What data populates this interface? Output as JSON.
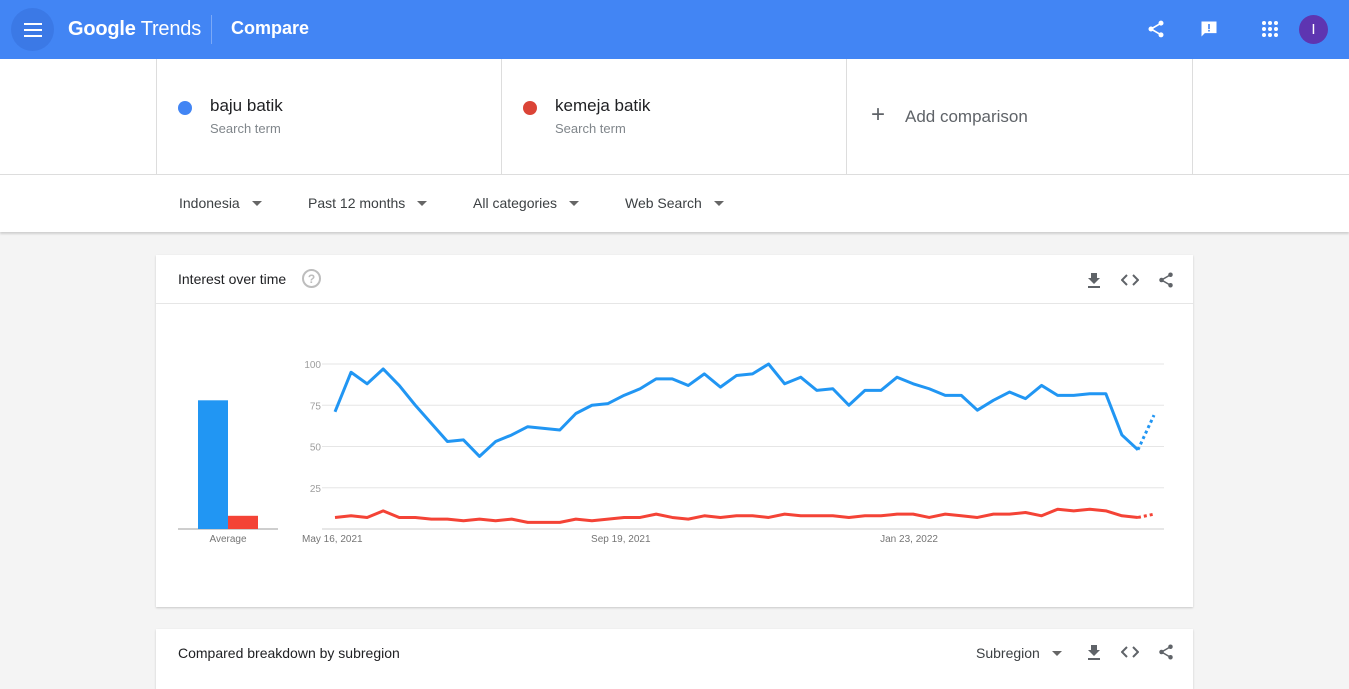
{
  "topbar": {
    "app_name_part1": "Google",
    "app_name_part2": "Trends",
    "page_title": "Compare",
    "avatar_initial": "I",
    "icons": [
      "menu-icon",
      "share-icon",
      "feedback-icon",
      "apps-grid-icon"
    ]
  },
  "terms": [
    {
      "name": "baju batik",
      "type": "Search term",
      "color": "#4285f4"
    },
    {
      "name": "kemeja batik",
      "type": "Search term",
      "color": "#db4437"
    }
  ],
  "add_comparison": "Add comparison",
  "filters": {
    "region": "Indonesia",
    "time": "Past 12 months",
    "category": "All categories",
    "search_type": "Web Search"
  },
  "interest_card": {
    "title": "Interest over time",
    "help": "?",
    "icons": [
      "download-icon",
      "embed-code-icon",
      "share-icon"
    ]
  },
  "subregion_card": {
    "title": "Compared breakdown by subregion",
    "selector": "Subregion"
  },
  "chart_data": {
    "type": "line",
    "title": "Interest over time",
    "xlabel": "",
    "ylabel": "",
    "ylim": [
      0,
      100
    ],
    "yticks": [
      25,
      50,
      75,
      100
    ],
    "grid": true,
    "x_tick_labels": [
      {
        "label": "May 16, 2021",
        "index": 0
      },
      {
        "label": "Sep 19, 2021",
        "index": 18
      },
      {
        "label": "Jan 23, 2022",
        "index": 36
      }
    ],
    "partial_last_point": true,
    "series": [
      {
        "name": "baju batik",
        "color": "#2196f3",
        "average": 78,
        "values": [
          71,
          95,
          88,
          97,
          87,
          75,
          64,
          53,
          54,
          44,
          53,
          57,
          62,
          61,
          60,
          70,
          75,
          76,
          81,
          85,
          91,
          91,
          87,
          94,
          86,
          93,
          94,
          100,
          88,
          92,
          84,
          85,
          75,
          84,
          84,
          92,
          88,
          85,
          81,
          81,
          72,
          78,
          83,
          79,
          87,
          81,
          81,
          82,
          82,
          57,
          48,
          69
        ]
      },
      {
        "name": "kemeja batik",
        "color": "#f44336",
        "average": 8,
        "values": [
          7,
          8,
          7,
          11,
          7,
          7,
          6,
          6,
          5,
          6,
          5,
          6,
          4,
          4,
          4,
          6,
          5,
          6,
          7,
          7,
          9,
          7,
          6,
          8,
          7,
          8,
          8,
          7,
          9,
          8,
          8,
          8,
          7,
          8,
          8,
          9,
          9,
          7,
          9,
          8,
          7,
          9,
          9,
          10,
          8,
          12,
          11,
          12,
          11,
          8,
          7,
          9
        ]
      }
    ],
    "average_label": "Average"
  }
}
